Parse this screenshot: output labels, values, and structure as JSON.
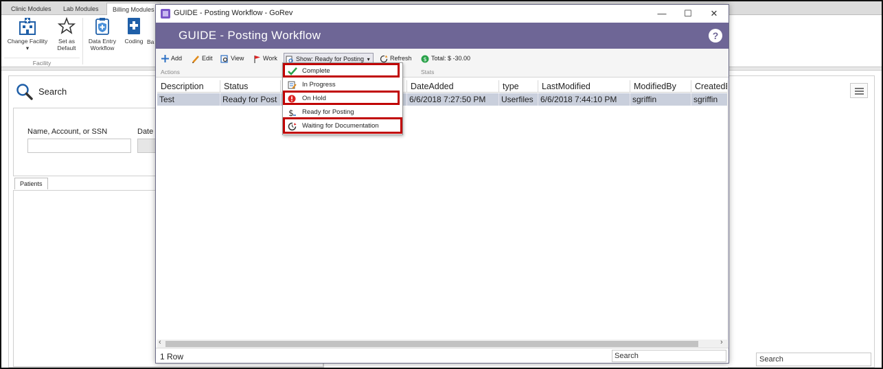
{
  "app": {
    "tabs": [
      "Clinic Modules",
      "Lab Modules",
      "Billing Modules"
    ],
    "ribbon": {
      "change_facility": "Change Facility",
      "set_default": [
        "Set as",
        "Default"
      ],
      "data_entry": [
        "Data Entry",
        "Workflow"
      ],
      "coding": "Coding",
      "ba": "Ba",
      "group_label": "Facility"
    },
    "search_panel": {
      "title": "Search",
      "name_label": "Name, Account, or SSN",
      "date_label": "Date o",
      "patients_tab": "Patients"
    },
    "search_placeholder": "Search"
  },
  "modal": {
    "window_title": "GUIDE - Posting Workflow - GoRev",
    "header_title": "GUIDE - Posting Workflow",
    "help": "?",
    "controls": {
      "minimize": "—",
      "maximize": "☐",
      "close": "✕"
    },
    "toolbar": {
      "add": "Add",
      "edit": "Edit",
      "view": "View",
      "work": "Work",
      "show": "Show: Ready for Posting",
      "refresh": "Refresh",
      "total": "Total: $ -30.00",
      "actions_label": "Actions",
      "stats_label": "Stats"
    },
    "grid": {
      "columns": [
        "Description",
        "Status",
        "",
        "DateAdded",
        "type",
        "LastModified",
        "ModifiedBy",
        "CreatedB"
      ],
      "rows": [
        [
          "Test",
          "Ready for Post",
          "",
          "6/6/2018 7:27:50 PM",
          "Userfiles",
          "6/6/2018 7:44:10 PM",
          "sgriffin",
          "sgriffin"
        ]
      ]
    },
    "footer": {
      "row_count": "1 Row",
      "search": "Search"
    },
    "dropdown": [
      {
        "label": "Complete",
        "icon": "check-icon",
        "highlighted": true
      },
      {
        "label": "In Progress",
        "icon": "note-icon",
        "highlighted": false
      },
      {
        "label": "On Hold",
        "icon": "alert-icon",
        "highlighted": true
      },
      {
        "label": "Ready for Posting",
        "icon": "dollar-icon",
        "highlighted": false
      },
      {
        "label": "Waiting for Documentation",
        "icon": "refresh-clock-icon",
        "highlighted": true
      }
    ]
  },
  "colors": {
    "header": "#6e6696",
    "highlight": "#c00000",
    "selected_row": "#c9cfdc"
  }
}
